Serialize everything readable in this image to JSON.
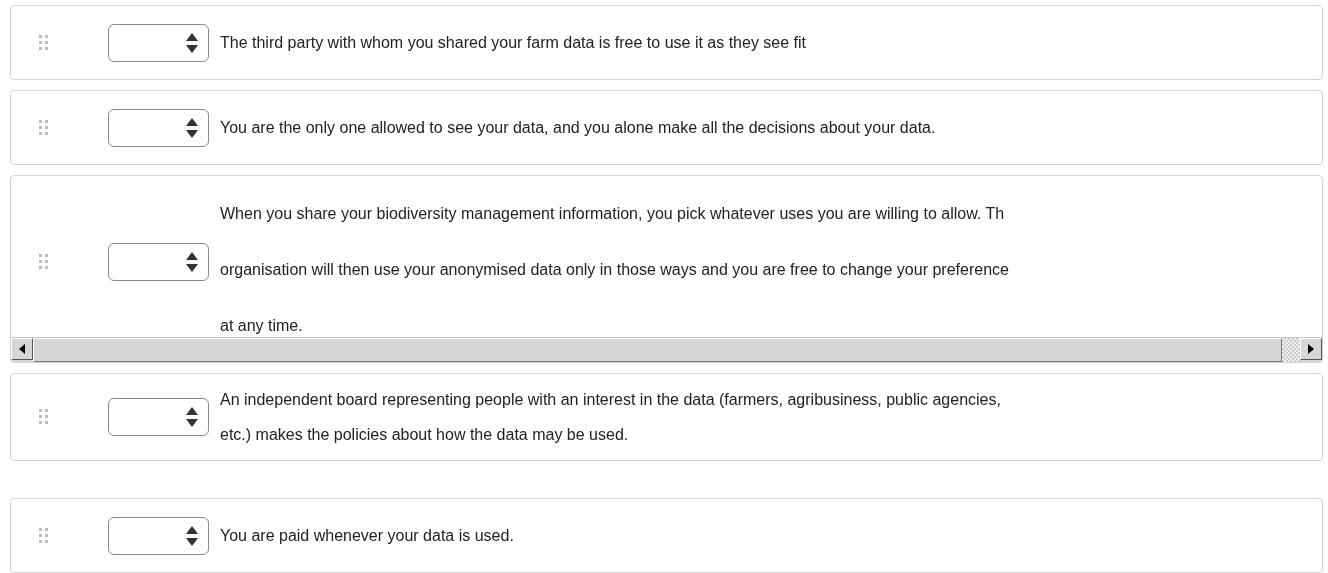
{
  "items": [
    {
      "kind": "plain",
      "lines": [
        "The third party with whom you shared your farm data is free to use it as they see fit"
      ]
    },
    {
      "kind": "plain",
      "lines": [
        "You are the only one allowed to see your data, and you alone make all the decisions about your data."
      ]
    },
    {
      "kind": "scroll",
      "lines": [
        "When you share your biodiversity management information, you pick whatever uses you are willing to allow. Th",
        "organisation will then use your anonymised data only in those ways and you are free to change your preference",
        "at any time."
      ]
    },
    {
      "kind": "plain",
      "lines": [
        "An independent board representing people with an interest in the data (farmers, agribusiness, public agencies,",
        "etc.) makes the policies about how the data may be used."
      ]
    },
    {
      "kind": "plain",
      "lines": [
        "You are paid whenever your data is used."
      ]
    }
  ]
}
